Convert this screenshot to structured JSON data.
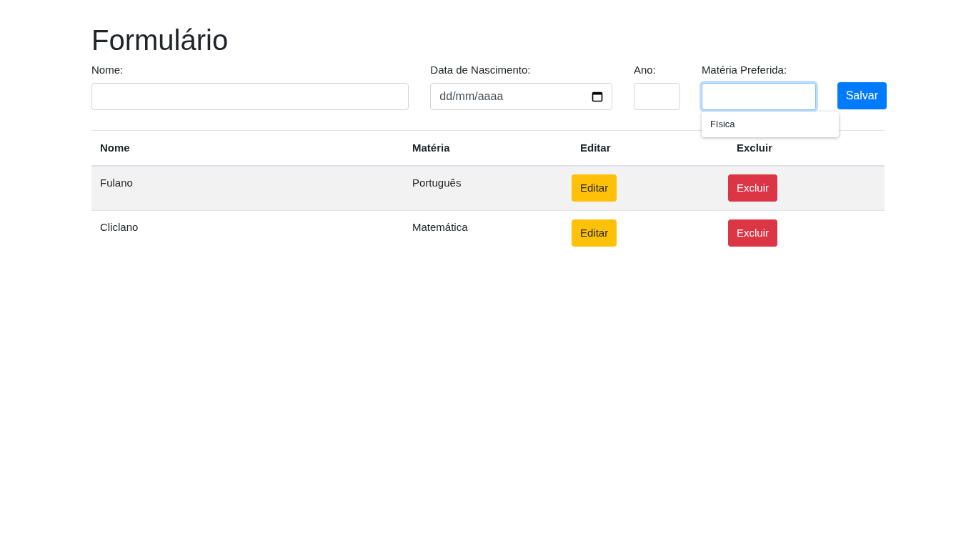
{
  "title": "Formulário",
  "form": {
    "fields": [
      {
        "kind": "text",
        "label": "Nome:",
        "focused": false
      },
      {
        "kind": "date",
        "label": "Data de Nascimento:",
        "placeholder": "dd/mm/aaaa",
        "focused": false
      },
      {
        "kind": "text",
        "label": "Ano:",
        "focused": false
      },
      {
        "kind": "text",
        "label": "Matéria Preferida:",
        "focused": true,
        "suggestions": [
          "Física"
        ]
      }
    ],
    "submit": "Salvar"
  },
  "table": {
    "columns": [
      "Nome",
      "Matéria",
      "Editar",
      "Excluir"
    ],
    "rows": [
      {
        "nome": "Fulano",
        "materia": "Português",
        "edit": "Editar",
        "delete": "Excluir"
      },
      {
        "nome": "Cliclano",
        "materia": "Matemática",
        "edit": "Editar",
        "delete": "Excluir"
      }
    ]
  }
}
